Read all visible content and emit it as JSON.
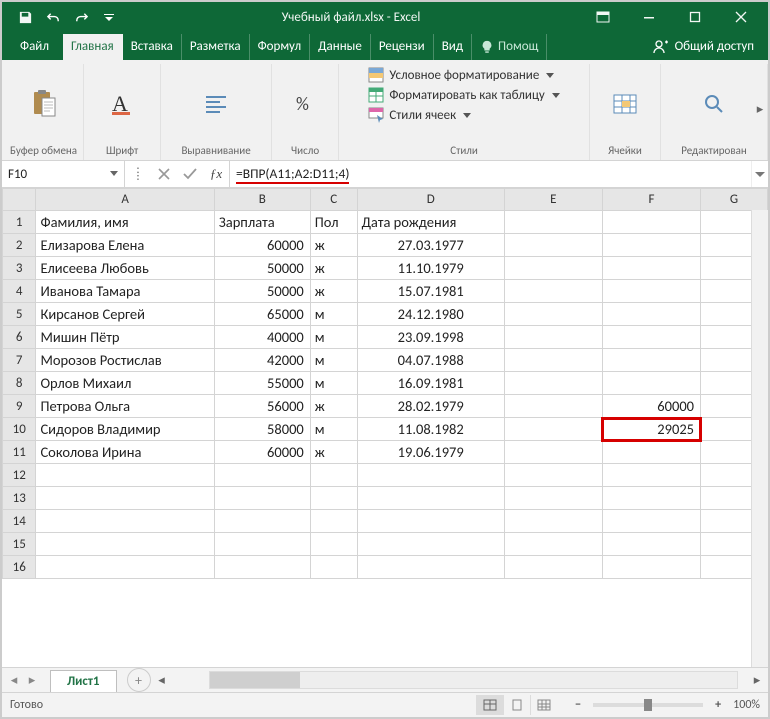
{
  "titlebar": {
    "title": "Учебный файл.xlsx - Excel"
  },
  "tabs": {
    "file": "Файл",
    "home": "Главная",
    "insert": "Вставка",
    "layout": "Разметка",
    "formulas": "Формул",
    "data": "Данные",
    "review": "Рецензи",
    "view": "Вид",
    "tell": "Помощ",
    "share": "Общий доступ"
  },
  "ribbon": {
    "clipboard": {
      "label": "Буфер обмена",
      "paste": ""
    },
    "font": {
      "label": "Шрифт"
    },
    "alignment": {
      "label": "Выравнивание"
    },
    "number": {
      "label": "Число"
    },
    "styles": {
      "label": "Стили",
      "conditional": "Условное форматирование",
      "astable": "Форматировать как таблицу",
      "cellstyles": "Стили ячеек"
    },
    "cells": {
      "label": "Ячейки"
    },
    "editing": {
      "label": "Редактирован"
    }
  },
  "formulaBar": {
    "nameBox": "F10",
    "formula": "=ВПР(A11;A2:D11;4)"
  },
  "columns": [
    "A",
    "B",
    "C",
    "D",
    "E",
    "F",
    "G"
  ],
  "headers": {
    "A": "Фамилия, имя",
    "B": "Зарплата",
    "C": "Пол",
    "D": "Дата рождения",
    "E": "",
    "F": "",
    "G": ""
  },
  "rows": [
    {
      "n": 1,
      "A": "Фамилия, имя",
      "B": "Зарплата",
      "C": "Пол",
      "D": "Дата рождения",
      "E": "",
      "F": "",
      "G": ""
    },
    {
      "n": 2,
      "A": "Елизарова Елена",
      "B": "60000",
      "C": "ж",
      "D": "27.03.1977",
      "E": "",
      "F": "",
      "G": ""
    },
    {
      "n": 3,
      "A": "Елисеева Любовь",
      "B": "50000",
      "C": "ж",
      "D": "11.10.1979",
      "E": "",
      "F": "",
      "G": ""
    },
    {
      "n": 4,
      "A": "Иванова Тамара",
      "B": "50000",
      "C": "ж",
      "D": "15.07.1981",
      "E": "",
      "F": "",
      "G": ""
    },
    {
      "n": 5,
      "A": "Кирсанов Сергей",
      "B": "65000",
      "C": "м",
      "D": "24.12.1980",
      "E": "",
      "F": "",
      "G": ""
    },
    {
      "n": 6,
      "A": "Мишин Пётр",
      "B": "40000",
      "C": "м",
      "D": "23.09.1998",
      "E": "",
      "F": "",
      "G": ""
    },
    {
      "n": 7,
      "A": "Морозов Ростислав",
      "B": "42000",
      "C": "м",
      "D": "04.07.1988",
      "E": "",
      "F": "",
      "G": ""
    },
    {
      "n": 8,
      "A": "Орлов Михаил",
      "B": "55000",
      "C": "м",
      "D": "16.09.1981",
      "E": "",
      "F": "",
      "G": ""
    },
    {
      "n": 9,
      "A": "Петрова Ольга",
      "B": "56000",
      "C": "ж",
      "D": "28.02.1979",
      "E": "",
      "F": "60000",
      "G": ""
    },
    {
      "n": 10,
      "A": "Сидоров Владимир",
      "B": "58000",
      "C": "м",
      "D": "11.08.1982",
      "E": "",
      "F": "29025",
      "G": ""
    },
    {
      "n": 11,
      "A": "Соколова Ирина",
      "B": "60000",
      "C": "ж",
      "D": "19.06.1979",
      "E": "",
      "F": "",
      "G": ""
    },
    {
      "n": 12,
      "A": "",
      "B": "",
      "C": "",
      "D": "",
      "E": "",
      "F": "",
      "G": ""
    },
    {
      "n": 13,
      "A": "",
      "B": "",
      "C": "",
      "D": "",
      "E": "",
      "F": "",
      "G": ""
    },
    {
      "n": 14,
      "A": "",
      "B": "",
      "C": "",
      "D": "",
      "E": "",
      "F": "",
      "G": ""
    },
    {
      "n": 15,
      "A": "",
      "B": "",
      "C": "",
      "D": "",
      "E": "",
      "F": "",
      "G": ""
    },
    {
      "n": 16,
      "A": "",
      "B": "",
      "C": "",
      "D": "",
      "E": "",
      "F": "",
      "G": ""
    }
  ],
  "sheetTab": "Лист1",
  "status": {
    "ready": "Готово",
    "zoom": "100%"
  },
  "activeCell": "F10",
  "highlightCell": "F10"
}
